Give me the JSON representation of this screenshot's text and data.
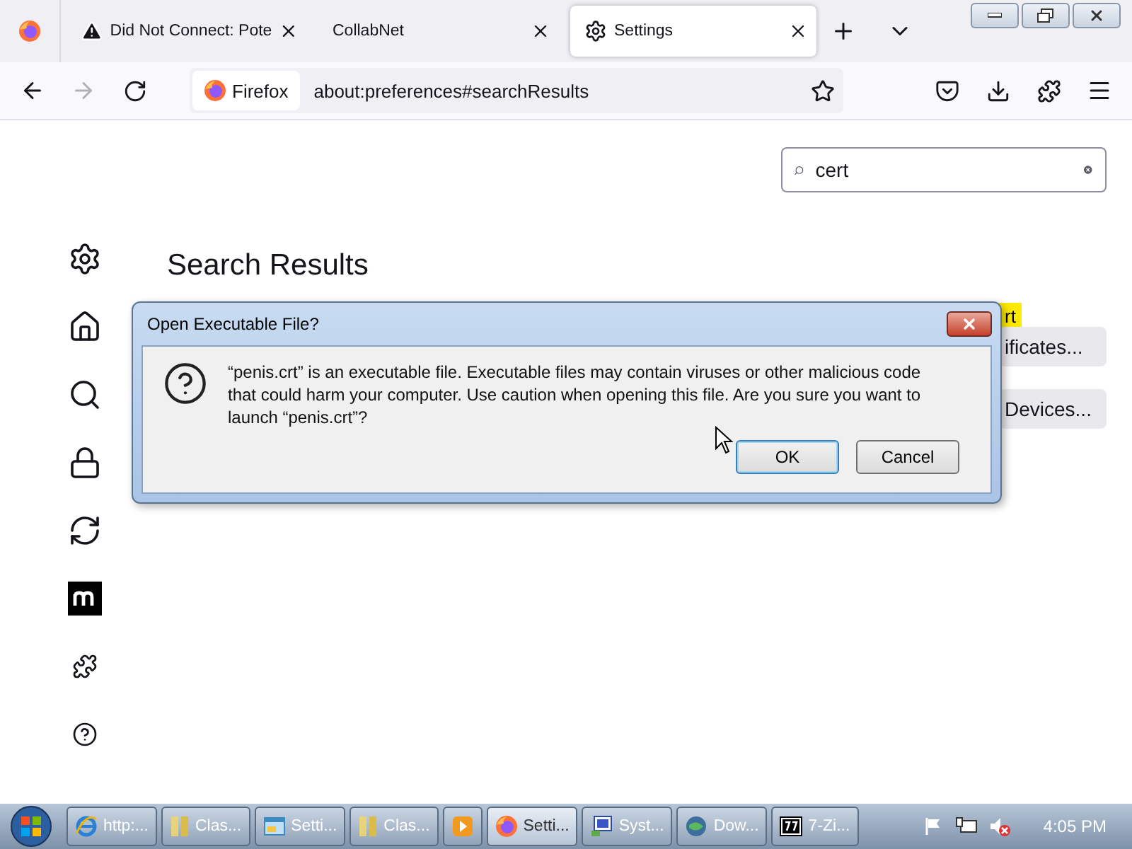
{
  "tabs": [
    {
      "kind": "warning",
      "label": "Did Not Connect: Pote",
      "selected": false
    },
    {
      "kind": "plain",
      "label": "CollabNet",
      "selected": false
    },
    {
      "kind": "settings",
      "label": "Settings",
      "selected": true
    }
  ],
  "toolbar": {
    "identity": "Firefox",
    "url": "about:preferences#searchResults"
  },
  "search": {
    "value": "cert"
  },
  "page": {
    "title": "Search Results",
    "highlight": "rt",
    "buttons": [
      "ificates...",
      "Devices..."
    ]
  },
  "sidebar": {
    "items": [
      {
        "kind": "settings"
      },
      {
        "kind": "home"
      },
      {
        "kind": "search"
      },
      {
        "kind": "privacy"
      },
      {
        "kind": "sync"
      },
      {
        "kind": "more"
      },
      {
        "kind": "extensions"
      },
      {
        "kind": "help"
      }
    ]
  },
  "dialog": {
    "title": "Open Executable File?",
    "message": "“penis.crt” is an executable file. Executable files may contain viruses or other malicious code that could harm your computer. Use caution when opening this file. Are you sure you want to launch “penis.crt”?",
    "buttons": [
      {
        "label": "OK",
        "default": true
      },
      {
        "label": "Cancel",
        "default": false
      }
    ]
  },
  "taskbar": {
    "items": [
      {
        "kind": "ie",
        "label": "http:...",
        "selected": false
      },
      {
        "kind": "folder",
        "label": "Clas...",
        "selected": false
      },
      {
        "kind": "settings",
        "label": "Setti...",
        "selected": false
      },
      {
        "kind": "folder",
        "label": "Clas...",
        "selected": false
      },
      {
        "kind": "media",
        "selected": false
      },
      {
        "kind": "firefox",
        "label": "Setti...",
        "selected": true
      },
      {
        "kind": "system",
        "label": "Syst...",
        "selected": false
      },
      {
        "kind": "download",
        "label": "Dow...",
        "selected": false
      },
      {
        "kind": "zip",
        "label": "7-Zi...",
        "selected": false
      }
    ],
    "clock": "4:05 PM"
  }
}
